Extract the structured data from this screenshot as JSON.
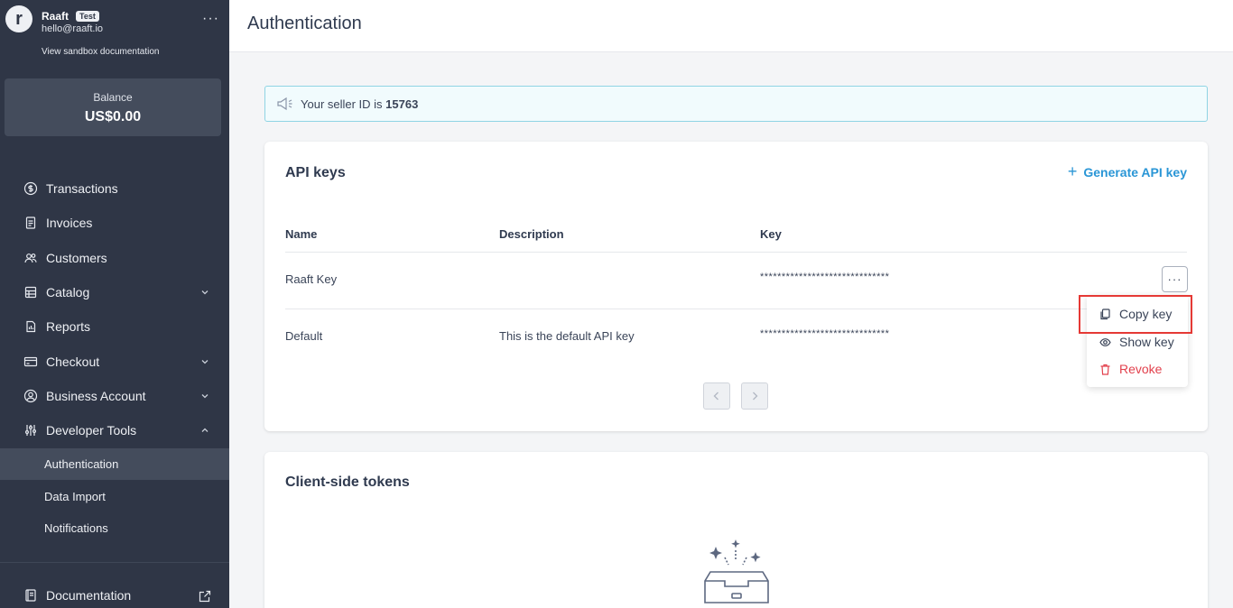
{
  "sidebar": {
    "avatar_letter": "r",
    "account_name": "Raaft",
    "badge": "Test",
    "email": "hello@raaft.io",
    "more": "···",
    "sandbox_link": "View sandbox documentation",
    "balance_label": "Balance",
    "balance_value": "US$0.00",
    "nav": [
      {
        "label": "Transactions",
        "icon": "dollar-circle-icon"
      },
      {
        "label": "Invoices",
        "icon": "invoice-icon"
      },
      {
        "label": "Customers",
        "icon": "users-icon"
      },
      {
        "label": "Catalog",
        "icon": "catalog-icon"
      },
      {
        "label": "Reports",
        "icon": "reports-icon"
      },
      {
        "label": "Checkout",
        "icon": "card-icon"
      },
      {
        "label": "Business Account",
        "icon": "user-circle-icon"
      },
      {
        "label": "Developer Tools",
        "icon": "sliders-icon"
      }
    ],
    "dev_sub": [
      "Authentication",
      "Data Import",
      "Notifications"
    ],
    "documentation": "Documentation"
  },
  "header": {
    "title": "Authentication"
  },
  "notice": {
    "text": "Your seller ID is ",
    "seller_id": "15763"
  },
  "api_keys": {
    "title": "API keys",
    "generate_plus": "+",
    "generate_label": "Generate API key",
    "columns": [
      "Name",
      "Description",
      "Key"
    ],
    "rows": [
      {
        "name": "Raaft Key",
        "description": "",
        "key": "******************************"
      },
      {
        "name": "Default",
        "description": "This is the default API key",
        "key": "******************************"
      }
    ],
    "row_menu": "···",
    "menu": {
      "copy": "Copy key",
      "show": "Show key",
      "revoke": "Revoke"
    }
  },
  "client_tokens": {
    "title": "Client-side tokens"
  },
  "colors": {
    "sidebar_bg": "#2f3646",
    "accent": "#2a96d6",
    "danger": "#e2414d",
    "highlight": "#e53935"
  }
}
